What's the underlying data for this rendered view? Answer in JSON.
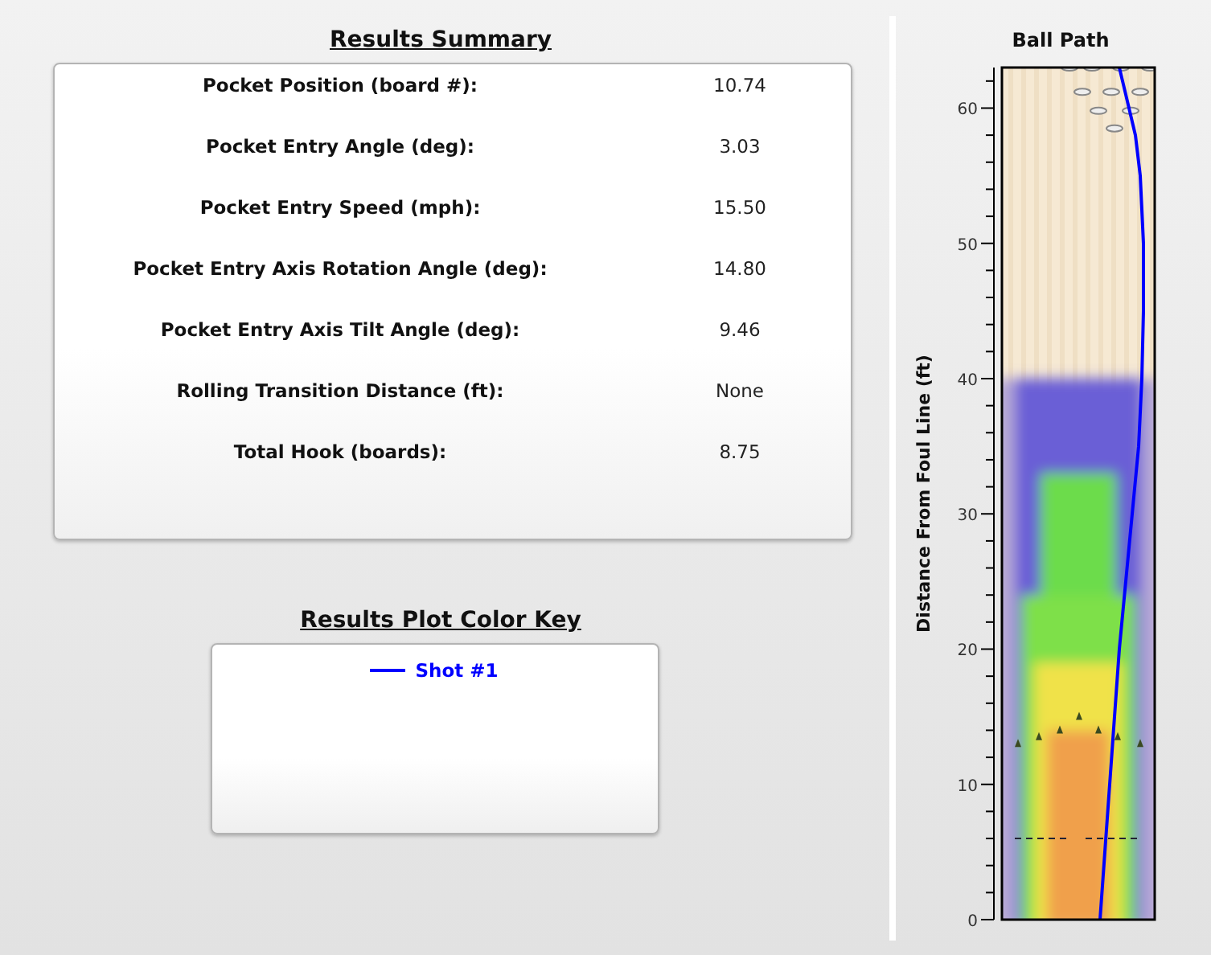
{
  "summary": {
    "title": "Results Summary",
    "rows": [
      {
        "label": "Pocket Position (board #):",
        "value": "10.74"
      },
      {
        "label": "Pocket Entry Angle (deg):",
        "value": "3.03"
      },
      {
        "label": "Pocket Entry Speed (mph):",
        "value": "15.50"
      },
      {
        "label": "Pocket Entry Axis Rotation Angle (deg):",
        "value": "14.80"
      },
      {
        "label": "Pocket Entry Axis Tilt Angle (deg):",
        "value": "9.46"
      },
      {
        "label": "Rolling Transition Distance (ft):",
        "value": "None"
      },
      {
        "label": "Total Hook (boards):",
        "value": "8.75"
      }
    ]
  },
  "color_key": {
    "title": "Results Plot Color Key",
    "entries": [
      {
        "label": "Shot #1",
        "color": "#0000ff"
      }
    ]
  },
  "ball_path": {
    "title": "Ball Path",
    "axis_title": "Distance From Foul Line (ft)",
    "tick_labels": [
      "60",
      "50",
      "40",
      "30",
      "20",
      "10",
      "0"
    ]
  }
}
